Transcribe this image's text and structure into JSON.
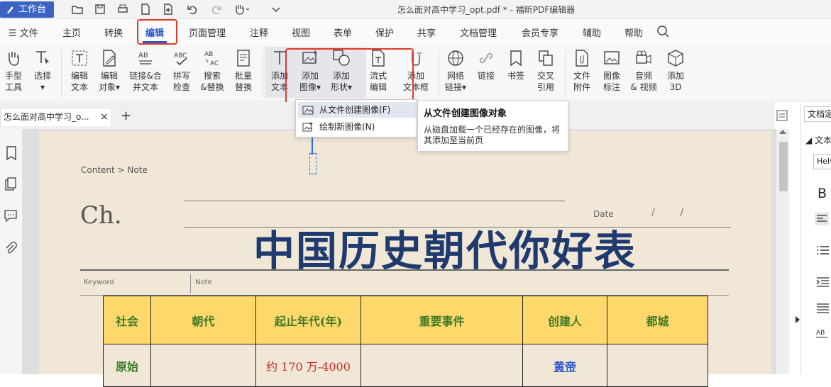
{
  "titlebar": {
    "workbench": "工作台",
    "quick_icons": [
      "open-folder-icon",
      "save-icon",
      "print-icon",
      "new-doc-icon",
      "add-icon",
      "undo-icon",
      "redo-icon",
      "hand-icon",
      "more-icon"
    ],
    "doc_title": "怎么面对高中学习_opt.pdf * - 福昕PDF编辑器"
  },
  "menu": {
    "file": "文件",
    "items": [
      "主页",
      "转换",
      "编辑",
      "页面管理",
      "注释",
      "视图",
      "表单",
      "保护",
      "共享",
      "文档管理",
      "会员专享",
      "辅助",
      "帮助"
    ],
    "active": "编辑"
  },
  "ribbon": {
    "tools": [
      {
        "id": "hand",
        "label": "手型\n工具"
      },
      {
        "id": "select",
        "label": "选择\n▾"
      },
      {
        "id": "edit-text",
        "label": "编辑\n文本"
      },
      {
        "id": "edit-object",
        "label": "编辑\n对象▾"
      },
      {
        "id": "link-merge",
        "label": "链接&合\n并文本"
      },
      {
        "id": "spell",
        "label": "拼写\n检查"
      },
      {
        "id": "search-replace",
        "label": "搜索\n&替换"
      },
      {
        "id": "batch-replace",
        "label": "批量\n替换"
      },
      {
        "id": "add-text",
        "label": "添加\n文本"
      },
      {
        "id": "add-image",
        "label": "添加\n图像▾"
      },
      {
        "id": "add-shape",
        "label": "添加\n形状▾"
      },
      {
        "id": "flow-edit",
        "label": "流式\n编辑"
      },
      {
        "id": "add-textbox",
        "label": "添加\n文本框"
      },
      {
        "id": "web-link",
        "label": "网络\n链接▾"
      },
      {
        "id": "link",
        "label": "链接"
      },
      {
        "id": "bookmark",
        "label": "书签"
      },
      {
        "id": "cross-ref",
        "label": "交叉\n引用"
      },
      {
        "id": "file-attach",
        "label": "文件\n附件"
      },
      {
        "id": "image-mark",
        "label": "图像\n标注"
      },
      {
        "id": "audio-video",
        "label": "音频\n& 视频"
      },
      {
        "id": "add-3d",
        "label": "添加\n3D"
      }
    ]
  },
  "dropdown": {
    "from_file": "从文件创建图像(F)",
    "draw_new": "绘制新图像(N)"
  },
  "tooltip": {
    "title": "从文件创建图像对象",
    "body": "从磁盘加载一个已经存在的图像，将其添加至当前页"
  },
  "tabs": {
    "doc_tab": "怎么面对高中学习_o...",
    "close": "×",
    "add": "+"
  },
  "right_panel": {
    "tab": "文档定",
    "section": "文本",
    "font": "Helv",
    "bold": "B"
  },
  "page": {
    "breadcrumb": "Content > Note",
    "ch": "Ch.",
    "date_label": "Date",
    "date_slashes": "/        /",
    "keyword": "Keyword",
    "note": "Note",
    "heading": "中国历史朝代你好表",
    "table": {
      "headers": [
        "社会",
        "朝代",
        "起止年代(年)",
        "重要事件",
        "创建人",
        "都城"
      ],
      "row1": [
        "原始",
        "",
        "约 170 万-4000",
        "",
        "黄帝",
        ""
      ]
    }
  },
  "colors": {
    "accent": "#2b55c9",
    "highlight_red": "#e0392b",
    "page_bg": "#f1e7d6",
    "header_yellow": "#ffd86b",
    "heading_navy": "#1e3a6e"
  }
}
